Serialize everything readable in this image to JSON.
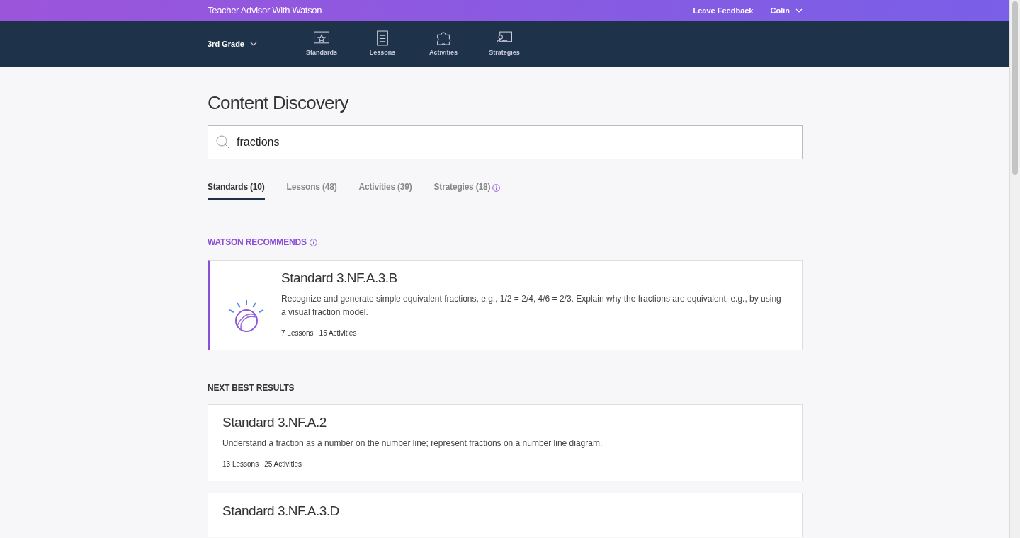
{
  "top_bar": {
    "title": "Teacher Advisor With Watson",
    "links": [
      {
        "label": "Leave Feedback",
        "kind": "link"
      },
      {
        "label": "Colin",
        "kind": "menu"
      }
    ]
  },
  "nav": {
    "grade": "3rd Grade",
    "items": [
      {
        "label": "Standards"
      },
      {
        "label": "Lessons"
      },
      {
        "label": "Activities"
      },
      {
        "label": "Strategies"
      }
    ]
  },
  "page_title": "Content Discovery",
  "search": {
    "value": "fractions"
  },
  "tabs": [
    {
      "label": "Standards (10)",
      "selected": true,
      "info": false
    },
    {
      "label": "Lessons (48)",
      "selected": false,
      "info": false
    },
    {
      "label": "Activities (39)",
      "selected": false,
      "info": false
    },
    {
      "label": "Strategies (18)",
      "selected": false,
      "info": true
    }
  ],
  "recommended": {
    "heading": "WATSON RECOMMENDS",
    "result": {
      "title": "Standard 3.NF.A.3.B",
      "description": "Recognize and generate simple equivalent fractions, e.g., 1/2 = 2/4, 4/6 = 2/3. Explain why the fractions are equivalent, e.g., by using a visual fraction model.",
      "lessons": "7 Lessons",
      "activities": "15 Activities"
    }
  },
  "next_best": {
    "heading": "NEXT BEST RESULTS",
    "results": [
      {
        "title": "Standard 3.NF.A.2",
        "description": "Understand a fraction as a number on the number line; represent fractions on a number line diagram.",
        "lessons": "13 Lessons",
        "activities": "25 Activities"
      },
      {
        "title": "Standard 3.NF.A.3.D"
      }
    ]
  }
}
